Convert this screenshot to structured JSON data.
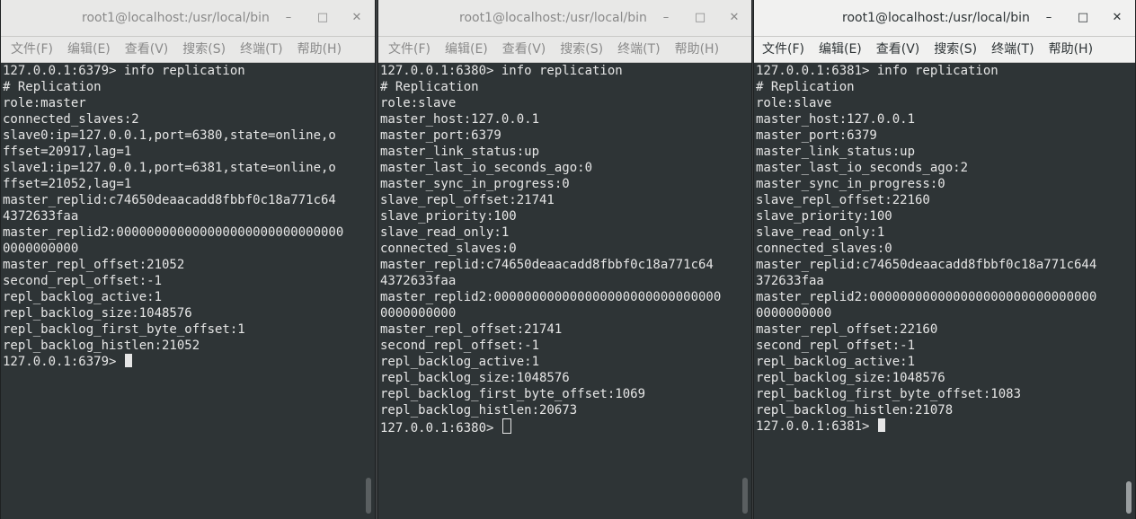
{
  "menu_labels": [
    "文件(F)",
    "编辑(E)",
    "查看(V)",
    "搜索(S)",
    "终端(T)",
    "帮助(H)"
  ],
  "window_buttons": {
    "minimize": "–",
    "maximize": "□",
    "close": "✕"
  },
  "windows": [
    {
      "title": "root1@localhost:/usr/local/bin",
      "lines": [
        "127.0.0.1:6379> info replication",
        "# Replication",
        "role:master",
        "connected_slaves:2",
        "slave0:ip=127.0.0.1,port=6380,state=online,o",
        "ffset=20917,lag=1",
        "slave1:ip=127.0.0.1,port=6381,state=online,o",
        "ffset=21052,lag=1",
        "master_replid:c74650deaacadd8fbbf0c18a771c64",
        "4372633faa",
        "master_replid2:000000000000000000000000000000",
        "0000000000",
        "master_repl_offset:21052",
        "second_repl_offset:-1",
        "repl_backlog_active:1",
        "repl_backlog_size:1048576",
        "repl_backlog_first_byte_offset:1",
        "repl_backlog_histlen:21052"
      ],
      "prompt": "127.0.0.1:6379> "
    },
    {
      "title": "root1@localhost:/usr/local/bin",
      "lines": [
        "127.0.0.1:6380> info replication",
        "# Replication",
        "role:slave",
        "master_host:127.0.0.1",
        "master_port:6379",
        "master_link_status:up",
        "master_last_io_seconds_ago:0",
        "master_sync_in_progress:0",
        "slave_repl_offset:21741",
        "slave_priority:100",
        "slave_read_only:1",
        "connected_slaves:0",
        "master_replid:c74650deaacadd8fbbf0c18a771c64",
        "4372633faa",
        "master_replid2:000000000000000000000000000000",
        "0000000000",
        "master_repl_offset:21741",
        "second_repl_offset:-1",
        "repl_backlog_active:1",
        "repl_backlog_size:1048576",
        "repl_backlog_first_byte_offset:1069",
        "repl_backlog_histlen:20673"
      ],
      "prompt": "127.0.0.1:6380> "
    },
    {
      "title": "root1@localhost:/usr/local/bin",
      "lines": [
        "127.0.0.1:6381> info replication",
        "# Replication",
        "role:slave",
        "master_host:127.0.0.1",
        "master_port:6379",
        "master_link_status:up",
        "master_last_io_seconds_ago:2",
        "master_sync_in_progress:0",
        "slave_repl_offset:22160",
        "slave_priority:100",
        "slave_read_only:1",
        "connected_slaves:0",
        "master_replid:c74650deaacadd8fbbf0c18a771c644",
        "372633faa",
        "master_replid2:000000000000000000000000000000",
        "0000000000",
        "master_repl_offset:22160",
        "second_repl_offset:-1",
        "repl_backlog_active:1",
        "repl_backlog_size:1048576",
        "repl_backlog_first_byte_offset:1083",
        "repl_backlog_histlen:21078"
      ],
      "prompt": "127.0.0.1:6381> "
    }
  ]
}
